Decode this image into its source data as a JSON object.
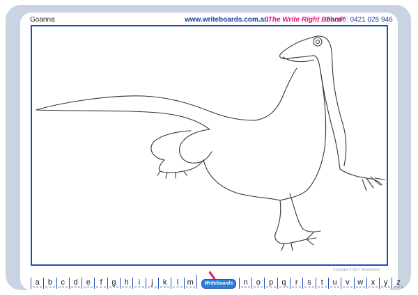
{
  "header": {
    "title": "Goanna",
    "site": "www.writeboards.com.au",
    "tagline": "\"The Write Right Board\"",
    "phone": "Phone: 0421 025 946"
  },
  "illustration": {
    "subject-icon": "goanna-lizard-outline"
  },
  "footer": {
    "copyright": "Copyright © 2017 Writeboards",
    "logo_text": "Writeboards",
    "letters_left": [
      "a",
      "b",
      "c",
      "d",
      "e",
      "f",
      "g",
      "h",
      "i",
      "j",
      "k",
      "l",
      "m"
    ],
    "letters_right": [
      "n",
      "o",
      "p",
      "q",
      "r",
      "s",
      "t",
      "u",
      "v",
      "w",
      "x",
      "y",
      "z"
    ]
  },
  "colors": {
    "frame": "#c9d3e2",
    "border_blue": "#1f4fb6",
    "brand_pink": "#e0127a"
  }
}
